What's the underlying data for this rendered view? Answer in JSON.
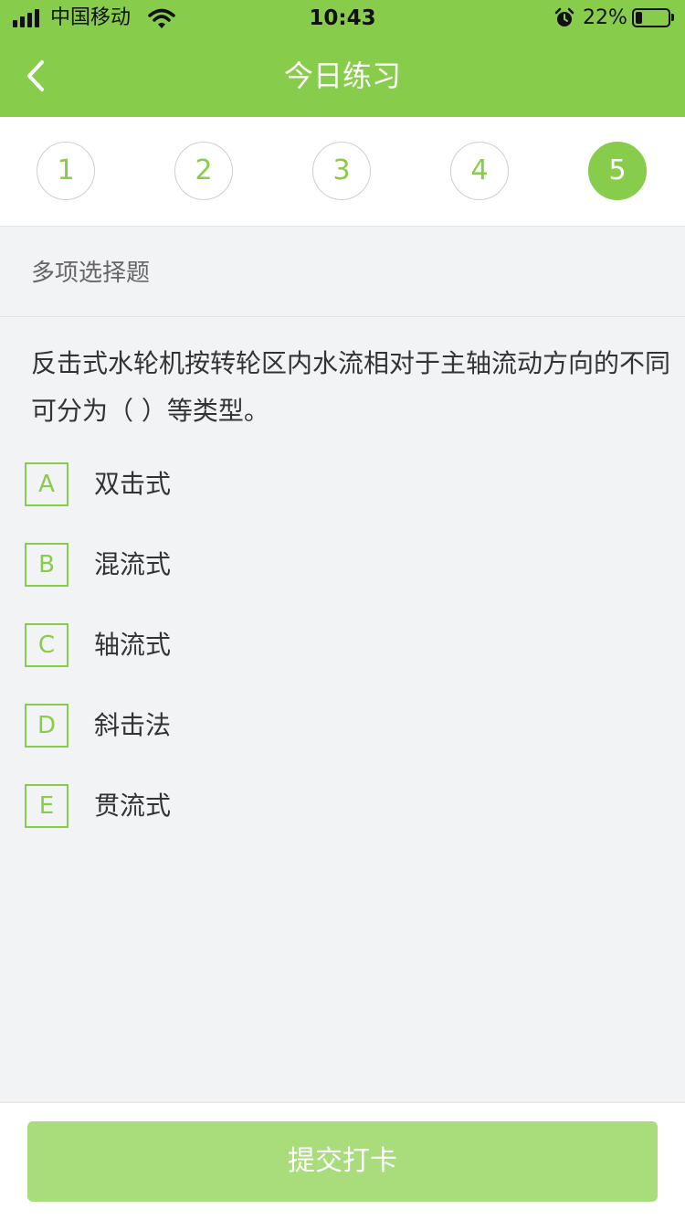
{
  "status_bar": {
    "carrier": "中国移动",
    "time": "10:43",
    "battery_percent": "22%",
    "battery_level": 0.22
  },
  "header": {
    "title": "今日练习",
    "back_icon": "chevron-left-icon"
  },
  "steps": {
    "items": [
      "1",
      "2",
      "3",
      "4",
      "5"
    ],
    "active": "5"
  },
  "question": {
    "type_label": "多项选择题",
    "text": "反击式水轮机按转轮区内水流相对于主轴流动方向的不同可分为（    ）等类型。",
    "options": [
      {
        "letter": "A",
        "text": "双击式"
      },
      {
        "letter": "B",
        "text": "混流式"
      },
      {
        "letter": "C",
        "text": "轴流式"
      },
      {
        "letter": "D",
        "text": "斜击法"
      },
      {
        "letter": "E",
        "text": "贯流式"
      }
    ]
  },
  "footer": {
    "submit_label": "提交打卡"
  },
  "colors": {
    "accent": "#88cc4b",
    "button_disabled": "#a9dc7b",
    "background": "#f2f3f5"
  }
}
